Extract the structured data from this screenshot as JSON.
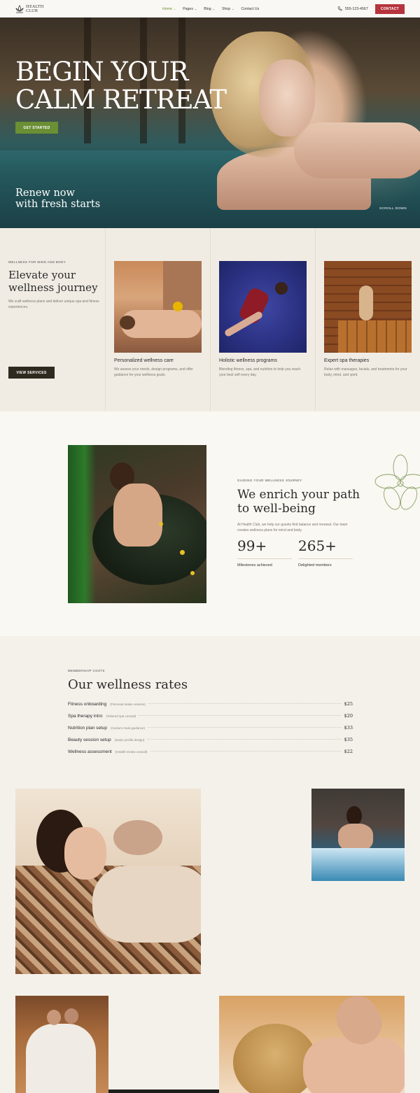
{
  "header": {
    "logo_line1": "HEALTH",
    "logo_line2": "CLUB",
    "nav": [
      {
        "label": "Home",
        "active": true,
        "has_chevron": true
      },
      {
        "label": "Pages",
        "active": false,
        "has_chevron": true
      },
      {
        "label": "Blog",
        "active": false,
        "has_chevron": true
      },
      {
        "label": "Shop",
        "active": false,
        "has_chevron": true
      },
      {
        "label": "Contact Us",
        "active": false,
        "has_chevron": false
      }
    ],
    "phone": "555-123-4567",
    "contact_label": "CONTACT"
  },
  "hero": {
    "title": "BEGIN YOUR CALM RETREAT",
    "cta": "GET STARTED",
    "subtitle_line1": "Renew now",
    "subtitle_line2": "with fresh starts",
    "scroll_label": "SCROLL DOWN"
  },
  "services": {
    "eyebrow": "WELLNESS FOR MIND AND BODY",
    "title": "Elevate your wellness journey",
    "description": "We craft wellness plans and deliver unique spa and fitness experiences.",
    "button": "VIEW SERVICES",
    "cards": [
      {
        "title": "Personalized wellness care",
        "desc": "We assess your needs, design programs, and offer guidance for your wellness goals."
      },
      {
        "title": "Holistic wellness programs",
        "desc": "Blending fitness, spa, and nutrition to help you reach your best self every day."
      },
      {
        "title": "Expert spa therapies",
        "desc": "Relax with massages, facials, and treatments for your body, mind, and spirit."
      }
    ]
  },
  "enrich": {
    "eyebrow": "GUIDING YOUR WELLNESS JOURNEY",
    "title": "We enrich your path to well-being",
    "description": "At Health Club, we help our guests find balance and renewal. Our team creates wellness plans for mind and body.",
    "stats": [
      {
        "value": "99+",
        "label": "Milestones achieved"
      },
      {
        "value": "265+",
        "label": "Delighted members"
      }
    ]
  },
  "rates": {
    "eyebrow": "MEMBERSHIP COSTS",
    "title": "Our wellness rates",
    "items": [
      {
        "name": "Fitness onboarding",
        "note": "(Personal intake session)",
        "price": "$25"
      },
      {
        "name": "Spa therapy intro",
        "note": "(Tailored spa consult)",
        "price": "$20"
      },
      {
        "name": "Nutrition plan setup",
        "note": "(Custom meal guidance)",
        "price": "$33"
      },
      {
        "name": "Beauty session setup",
        "note": "(Salon profile design)",
        "price": "$35"
      },
      {
        "name": "Wellness assessment",
        "note": "(Health review consult)",
        "price": "$22"
      }
    ]
  },
  "colors": {
    "accent_green": "#6a8f34",
    "accent_red": "#b6343d",
    "dark_button": "#2f2a20",
    "background": "#f4f1eb"
  }
}
